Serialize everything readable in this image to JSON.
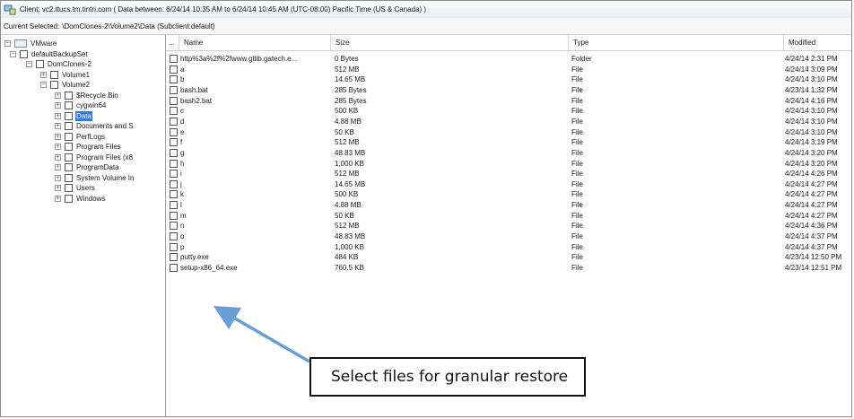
{
  "titlebar": {
    "text": "Client: vc2.ttucs.tm.tintri.com ( Data between: 6/24/14 10:35 AM to 6/24/14 10:45 AM (UTC-08:00) Pacific Time (US & Canada) )"
  },
  "current": {
    "label": "Current Selected:",
    "value": "\\DomClones-2\\Volume2\\Data (Subclient:default)"
  },
  "tree": [
    {
      "label": "VMware",
      "depth": 0,
      "expander": "−",
      "icon": "folder-icon"
    },
    {
      "label": "defaultBackupSet",
      "depth": 1,
      "expander": "−",
      "icon": "checkbox"
    },
    {
      "label": "DomClones-2",
      "depth": 2,
      "expander": "−",
      "icon": "checkbox"
    },
    {
      "label": "Volume1",
      "depth": 3,
      "expander": "+",
      "icon": "checkbox"
    },
    {
      "label": "Volume2",
      "depth": 3,
      "expander": "−",
      "icon": "checkbox"
    },
    {
      "label": "$Recycle.Bin",
      "depth": 4,
      "expander": "+",
      "icon": "checkbox"
    },
    {
      "label": "cygwin64",
      "depth": 4,
      "expander": "+",
      "icon": "checkbox"
    },
    {
      "label": "Data",
      "depth": 4,
      "expander": "+",
      "icon": "checkbox",
      "selected": true
    },
    {
      "label": "Documents and S",
      "depth": 4,
      "expander": "+",
      "icon": "checkbox"
    },
    {
      "label": "PerfLogs",
      "depth": 4,
      "expander": "+",
      "icon": "checkbox"
    },
    {
      "label": "Program Files",
      "depth": 4,
      "expander": "+",
      "icon": "checkbox"
    },
    {
      "label": "Program Files (x8",
      "depth": 4,
      "expander": "+",
      "icon": "checkbox"
    },
    {
      "label": "ProgramData",
      "depth": 4,
      "expander": "+",
      "icon": "checkbox"
    },
    {
      "label": "System Volume In",
      "depth": 4,
      "expander": "+",
      "icon": "checkbox"
    },
    {
      "label": "Users",
      "depth": 4,
      "expander": "+",
      "icon": "checkbox"
    },
    {
      "label": "Windows",
      "depth": 4,
      "expander": "+",
      "icon": "checkbox"
    }
  ],
  "grid": {
    "columns": [
      "...",
      "Name",
      "Size",
      "Type",
      "Modified"
    ],
    "rows": [
      {
        "name": "http%3a%2f%2fwww.gtlib.gatech.e...",
        "size": "0 Bytes",
        "type": "Folder",
        "modified": "4/24/14 2:31 PM"
      },
      {
        "name": "a",
        "size": "512 MB",
        "type": "File",
        "modified": "4/24/14 3:09 PM"
      },
      {
        "name": "b",
        "size": "14.65 MB",
        "type": "File",
        "modified": "4/24/14 3:10 PM"
      },
      {
        "name": "bash.bat",
        "size": "285 Bytes",
        "type": "File",
        "modified": "4/23/14 1:32 PM"
      },
      {
        "name": "bash2.bat",
        "size": "285 Bytes",
        "type": "File",
        "modified": "4/24/14 4:16 PM"
      },
      {
        "name": "c",
        "size": "500 KB",
        "type": "File",
        "modified": "4/24/14 3:10 PM"
      },
      {
        "name": "d",
        "size": "4.88 MB",
        "type": "File",
        "modified": "4/24/14 3:10 PM"
      },
      {
        "name": "e",
        "size": "50 KB",
        "type": "File",
        "modified": "4/24/14 3:10 PM"
      },
      {
        "name": "f",
        "size": "512 MB",
        "type": "File",
        "modified": "4/24/14 3:19 PM"
      },
      {
        "name": "g",
        "size": "48.83 MB",
        "type": "File",
        "modified": "4/24/14 3:20 PM"
      },
      {
        "name": "h",
        "size": "1,000 KB",
        "type": "File",
        "modified": "4/24/14 3:20 PM"
      },
      {
        "name": "i",
        "size": "512 MB",
        "type": "File",
        "modified": "4/24/14 4:26 PM"
      },
      {
        "name": "j",
        "size": "14.65 MB",
        "type": "File",
        "modified": "4/24/14 4:27 PM"
      },
      {
        "name": "k",
        "size": "500 KB",
        "type": "File",
        "modified": "4/24/14 4:27 PM"
      },
      {
        "name": "l",
        "size": "4.88 MB",
        "type": "File",
        "modified": "4/24/14 4:27 PM"
      },
      {
        "name": "m",
        "size": "50 KB",
        "type": "File",
        "modified": "4/24/14 4:27 PM"
      },
      {
        "name": "n",
        "size": "512 MB",
        "type": "File",
        "modified": "4/24/14 4:36 PM"
      },
      {
        "name": "o",
        "size": "48.83 MB",
        "type": "File",
        "modified": "4/24/14 4:37 PM"
      },
      {
        "name": "p",
        "size": "1,000 KB",
        "type": "File",
        "modified": "4/24/14 4:37 PM"
      },
      {
        "name": "putty.exe",
        "size": "484 KB",
        "type": "File",
        "modified": "4/23/14 12:50 PM"
      },
      {
        "name": "setup-x86_64.exe",
        "size": "760.5 KB",
        "type": "File",
        "modified": "4/23/14 12:51 PM"
      }
    ]
  },
  "callout": {
    "text": "Select files for granular restore"
  },
  "colors": {
    "selection": "#3b76d1",
    "arrow": "#6a9fd6",
    "titlebar": "#e8edf5"
  }
}
